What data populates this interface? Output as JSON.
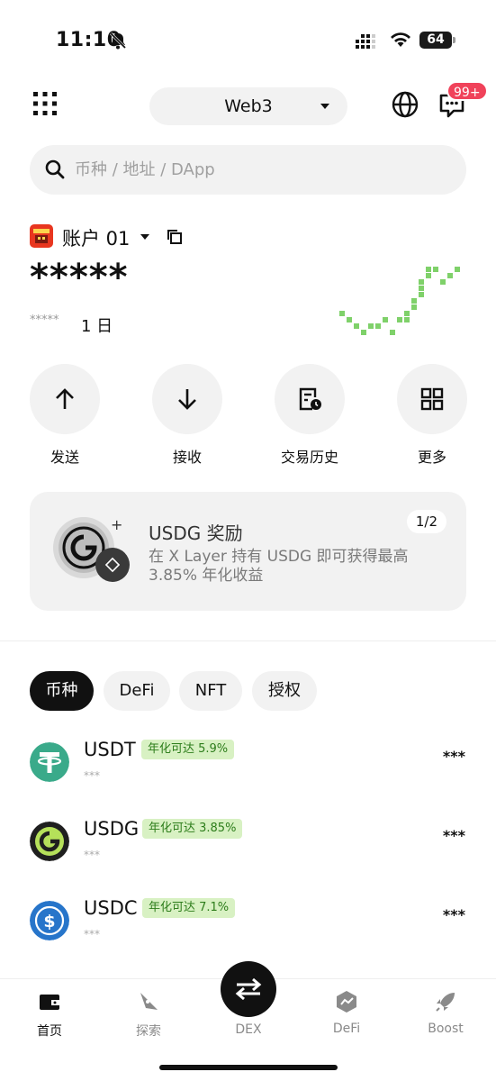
{
  "status_bar": {
    "time": "11:10",
    "battery": "64"
  },
  "header": {
    "network": "Web3",
    "notification_badge": "99+"
  },
  "search": {
    "placeholder": "币种 / 地址 / DApp"
  },
  "account": {
    "name": "账户 01",
    "balance": "*****",
    "pnl": "*****",
    "period": "1 日",
    "sparkline_color": "#7fd16a"
  },
  "actions": [
    {
      "label": "发送",
      "icon": "arrow-up-icon"
    },
    {
      "label": "接收",
      "icon": "arrow-down-icon"
    },
    {
      "label": "交易历史",
      "icon": "history-icon"
    },
    {
      "label": "更多",
      "icon": "grid-icon"
    }
  ],
  "promo": {
    "title": "USDG 奖励",
    "description": "在 X Layer 持有 USDG 即可获得最高 3.85% 年化收益",
    "pager": "1/2"
  },
  "tabs": [
    {
      "label": "币种",
      "active": true
    },
    {
      "label": "DeFi",
      "active": false
    },
    {
      "label": "NFT",
      "active": false
    },
    {
      "label": "授权",
      "active": false
    }
  ],
  "tokens": [
    {
      "symbol": "USDT",
      "apy": "年化可达 5.9%",
      "sub": "***",
      "amount": "***",
      "color": "#3aaa8a"
    },
    {
      "symbol": "USDG",
      "apy": "年化可达 3.85%",
      "sub": "***",
      "amount": "***",
      "color": "#1f1f1f"
    },
    {
      "symbol": "USDC",
      "apy": "年化可达 7.1%",
      "sub": "***",
      "amount": "***",
      "color": "#2775ca"
    }
  ],
  "bottom_nav": [
    {
      "label": "首页",
      "icon": "wallet-icon",
      "active": true
    },
    {
      "label": "探索",
      "icon": "compass-icon",
      "active": false
    },
    {
      "label": "DEX",
      "icon": "swap-icon",
      "active": false
    },
    {
      "label": "DeFi",
      "icon": "defi-icon",
      "active": false
    },
    {
      "label": "Boost",
      "icon": "rocket-icon",
      "active": false
    }
  ],
  "colors": {
    "accent": "#111111",
    "apy_bg": "#d8f1c3",
    "apy_text": "#2d7d1b",
    "badge": "#f0425a"
  }
}
